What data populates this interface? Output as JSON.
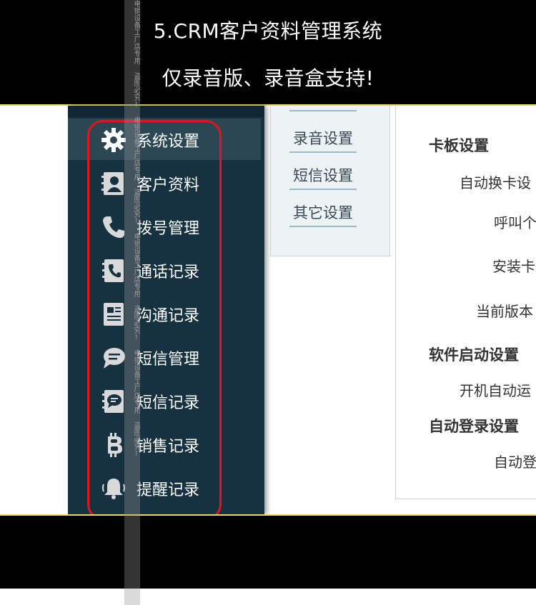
{
  "banner": {
    "title": "5.CRM客户资料管理系统",
    "subtitle": "仅录音版、录音盒支持!"
  },
  "sidebar": {
    "items": [
      {
        "label": "系统设置",
        "icon": "gear-icon",
        "active": true
      },
      {
        "label": "客户资料",
        "icon": "contact-card-icon"
      },
      {
        "label": "拨号管理",
        "icon": "phone-icon"
      },
      {
        "label": "通话记录",
        "icon": "phone-book-icon"
      },
      {
        "label": "沟通记录",
        "icon": "notes-icon"
      },
      {
        "label": "短信管理",
        "icon": "chat-bubble-icon"
      },
      {
        "label": "短信记录",
        "icon": "message-log-icon"
      },
      {
        "label": "销售记录",
        "icon": "bitcoin-icon"
      },
      {
        "label": "提醒记录",
        "icon": "bell-icon"
      }
    ]
  },
  "submenu": {
    "items": [
      "录音设置",
      "短信设置",
      "其它设置"
    ]
  },
  "content": {
    "section_card": "卡板设置",
    "auto_switch": "自动换卡设",
    "call": "呼叫个",
    "install": "安装卡",
    "version": "当前版本",
    "section_startup": "软件启动设置",
    "boot_run": "开机自动运",
    "section_login": "自动登录设置",
    "auto_login": "自动登"
  },
  "watermark": {
    "text": "电销设备工厂店专用 盗图必究! 电销设备工厂店专用 盗图必究! 电销设备工厂店专用 盗图必究! 电销设备工厂店专用 盗图必究!"
  }
}
